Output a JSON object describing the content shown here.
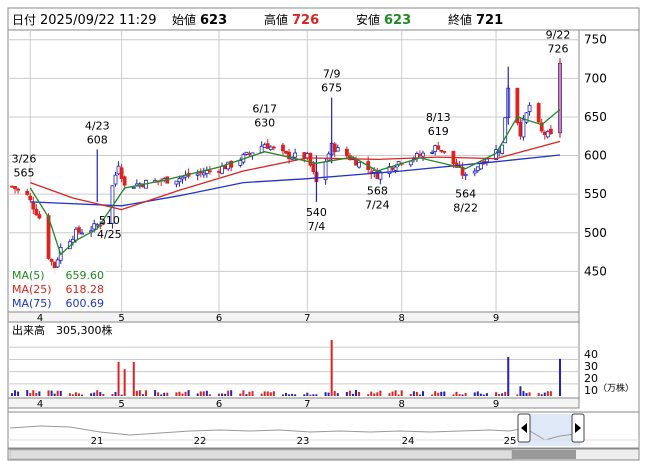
{
  "header": {
    "date_label": "日付",
    "datetime": "2025/09/22 11:29",
    "open_label": "始値",
    "open_value": "623",
    "high_label": "高値",
    "high_value": "726",
    "low_label": "安値",
    "low_value": "623",
    "close_label": "終値",
    "close_value": "721"
  },
  "colors": {
    "up": "#2222bb",
    "down": "#dd2222",
    "ma5": "#228822",
    "ma25": "#dd2222",
    "ma75": "#2233cc",
    "grid": "#cccccc",
    "high_value": "#dd2222",
    "low_value": "#228822"
  },
  "legend": [
    {
      "label": "MA(5)",
      "value": "659.60",
      "color": "#228822"
    },
    {
      "label": "MA(25)",
      "value": "618.28",
      "color": "#dd2222"
    },
    {
      "label": "MA(75)",
      "value": "600.69",
      "color": "#2233cc"
    }
  ],
  "volume_panel": {
    "label": "出来高",
    "value": "305,300株",
    "unit": "（万株）",
    "ticks": [
      "40",
      "30",
      "20",
      "10"
    ]
  },
  "navigator": {
    "labels": [
      "21",
      "22",
      "23",
      "24",
      "25"
    ]
  },
  "chart_data": {
    "type": "candlestick",
    "title": "",
    "ylim": [
      400,
      760
    ],
    "y_ticks": [
      450,
      500,
      550,
      600,
      650,
      700,
      750
    ],
    "month_labels": [
      {
        "label": "4",
        "date": "2025-04-01"
      },
      {
        "label": "5",
        "date": "2025-05-01"
      },
      {
        "label": "6",
        "date": "2025-06-02"
      },
      {
        "label": "7",
        "date": "2025-07-01"
      },
      {
        "label": "8",
        "date": "2025-08-01"
      },
      {
        "label": "9",
        "date": "2025-09-01"
      }
    ],
    "annotations": [
      {
        "date": "3/26",
        "value": "565",
        "kind": "high"
      },
      {
        "date": "4/25",
        "value": "510",
        "kind": "low"
      },
      {
        "date": "4/23",
        "value": "608",
        "kind": "high"
      },
      {
        "date": "6/17",
        "value": "630",
        "kind": "high"
      },
      {
        "date": "7/4",
        "value": "540",
        "kind": "low"
      },
      {
        "date": "7/9",
        "value": "675",
        "kind": "high"
      },
      {
        "date": "7/24",
        "value": "568",
        "kind": "low"
      },
      {
        "date": "8/13",
        "value": "619",
        "kind": "high"
      },
      {
        "date": "8/22",
        "value": "564",
        "kind": "low"
      },
      {
        "date": "9/22",
        "value": "726",
        "kind": "high"
      }
    ],
    "price_path": [
      {
        "date": "2025-03-26",
        "close": 560
      },
      {
        "date": "2025-03-31",
        "close": 548
      },
      {
        "date": "2025-04-04",
        "close": 520
      },
      {
        "date": "2025-04-07",
        "close": 470
      },
      {
        "date": "2025-04-09",
        "close": 455
      },
      {
        "date": "2025-04-11",
        "close": 480
      },
      {
        "date": "2025-04-16",
        "close": 500
      },
      {
        "date": "2025-04-21",
        "close": 505
      },
      {
        "date": "2025-04-25",
        "close": 515
      },
      {
        "date": "2025-04-30",
        "close": 590
      },
      {
        "date": "2025-05-02",
        "close": 560
      },
      {
        "date": "2025-05-09",
        "close": 565
      },
      {
        "date": "2025-05-19",
        "close": 570
      },
      {
        "date": "2025-05-28",
        "close": 578
      },
      {
        "date": "2025-06-06",
        "close": 588
      },
      {
        "date": "2025-06-17",
        "close": 615
      },
      {
        "date": "2025-06-24",
        "close": 600
      },
      {
        "date": "2025-07-01",
        "close": 598
      },
      {
        "date": "2025-07-04",
        "close": 565
      },
      {
        "date": "2025-07-09",
        "close": 612
      },
      {
        "date": "2025-07-16",
        "close": 595
      },
      {
        "date": "2025-07-24",
        "close": 575
      },
      {
        "date": "2025-07-31",
        "close": 592
      },
      {
        "date": "2025-08-07",
        "close": 600
      },
      {
        "date": "2025-08-13",
        "close": 612
      },
      {
        "date": "2025-08-22",
        "close": 572
      },
      {
        "date": "2025-08-29",
        "close": 598
      },
      {
        "date": "2025-09-03",
        "close": 612
      },
      {
        "date": "2025-09-05",
        "close": 690
      },
      {
        "date": "2025-09-09",
        "close": 630
      },
      {
        "date": "2025-09-12",
        "close": 665
      },
      {
        "date": "2025-09-16",
        "close": 630
      },
      {
        "date": "2025-09-19",
        "close": 625
      },
      {
        "date": "2025-09-22",
        "close": 721
      }
    ],
    "ma5": [
      {
        "date": "2025-04-01",
        "value": 558
      },
      {
        "date": "2025-04-07",
        "value": 520
      },
      {
        "date": "2025-04-11",
        "value": 472
      },
      {
        "date": "2025-04-16",
        "value": 490
      },
      {
        "date": "2025-04-23",
        "value": 505
      },
      {
        "date": "2025-05-02",
        "value": 558
      },
      {
        "date": "2025-05-15",
        "value": 568
      },
      {
        "date": "2025-06-02",
        "value": 585
      },
      {
        "date": "2025-06-17",
        "value": 605
      },
      {
        "date": "2025-07-04",
        "value": 590
      },
      {
        "date": "2025-07-16",
        "value": 598
      },
      {
        "date": "2025-07-24",
        "value": 580
      },
      {
        "date": "2025-08-07",
        "value": 597
      },
      {
        "date": "2025-08-22",
        "value": 583
      },
      {
        "date": "2025-09-01",
        "value": 603
      },
      {
        "date": "2025-09-08",
        "value": 650
      },
      {
        "date": "2025-09-16",
        "value": 640
      },
      {
        "date": "2025-09-22",
        "value": 659.6
      }
    ],
    "ma25": [
      {
        "date": "2025-04-01",
        "value": 565
      },
      {
        "date": "2025-04-15",
        "value": 545
      },
      {
        "date": "2025-05-01",
        "value": 530
      },
      {
        "date": "2025-05-20",
        "value": 555
      },
      {
        "date": "2025-06-10",
        "value": 580
      },
      {
        "date": "2025-07-01",
        "value": 597
      },
      {
        "date": "2025-07-24",
        "value": 595
      },
      {
        "date": "2025-08-13",
        "value": 598
      },
      {
        "date": "2025-09-01",
        "value": 596
      },
      {
        "date": "2025-09-22",
        "value": 618.28
      }
    ],
    "ma75": [
      {
        "date": "2025-04-01",
        "value": 540
      },
      {
        "date": "2025-05-01",
        "value": 535
      },
      {
        "date": "2025-05-20",
        "value": 548
      },
      {
        "date": "2025-06-10",
        "value": 565
      },
      {
        "date": "2025-07-01",
        "value": 570
      },
      {
        "date": "2025-08-01",
        "value": 580
      },
      {
        "date": "2025-09-01",
        "value": 592
      },
      {
        "date": "2025-09-22",
        "value": 600.69
      }
    ],
    "volume_spikes": [
      {
        "date": "2025-04-30",
        "volume": 28
      },
      {
        "date": "2025-05-02",
        "volume": 22
      },
      {
        "date": "2025-05-05",
        "volume": 28
      },
      {
        "date": "2025-07-09",
        "volume": 46
      },
      {
        "date": "2025-09-05",
        "volume": 32
      },
      {
        "date": "2025-09-09",
        "volume": 8
      },
      {
        "date": "2025-09-22",
        "volume": 30.53
      }
    ]
  }
}
